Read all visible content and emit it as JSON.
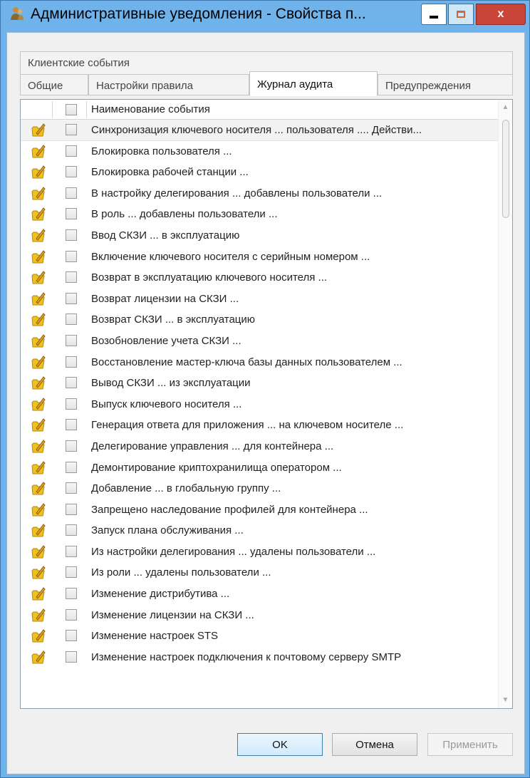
{
  "window": {
    "title": "Административные уведомления - Свойства п...",
    "close_glyph": "x"
  },
  "tabs": {
    "back_row": [
      "Клиентские события"
    ],
    "front_row": [
      {
        "label": "Общие",
        "active": false
      },
      {
        "label": "Настройки правила",
        "active": false
      },
      {
        "label": "Журнал аудита",
        "active": true
      },
      {
        "label": "Предупреждения",
        "active": false
      }
    ]
  },
  "list": {
    "column_header": "Наименование события",
    "row_icon": "folder-pencil-icon",
    "items": [
      "Синхронизация ключевого носителя ... пользователя .... Действи...",
      "Блокировка пользователя ...",
      "Блокировка рабочей станции ...",
      "В настройку делегирования ... добавлены пользователи ...",
      "В роль ... добавлены пользователи ...",
      "Ввод СКЗИ ... в эксплуатацию",
      "Включение ключевого носителя с серийным номером ...",
      "Возврат в эксплуатацию ключевого носителя ...",
      "Возврат лицензии на СКЗИ ...",
      "Возврат СКЗИ ... в эксплуатацию",
      "Возобновление учета СКЗИ ...",
      "Восстановление мастер-ключа базы данных пользователем ...",
      "Вывод СКЗИ ... из эксплуатации",
      "Выпуск ключевого носителя ...",
      "Генерация ответа для приложения ... на ключевом носителе ...",
      "Делегирование управления ... для контейнера ...",
      "Демонтирование криптохранилища оператором ...",
      "Добавление ... в глобальную группу ...",
      "Запрещено наследование профилей для контейнера ...",
      "Запуск плана обслуживания ...",
      "Из настройки делегирования ... удалены пользователи ...",
      "Из роли ... удалены пользователи ...",
      "Изменение дистрибутива ...",
      "Изменение лицензии на СКЗИ ...",
      "Изменение настроек STS",
      "Изменение настроек подключения к почтовому серверу SMTP"
    ]
  },
  "buttons": {
    "ok": "OK",
    "cancel": "Отмена",
    "apply": "Применить"
  },
  "colors": {
    "titlebar": "#6fb3ea",
    "close_button": "#c9453a",
    "row_icon": "#f0c020"
  }
}
